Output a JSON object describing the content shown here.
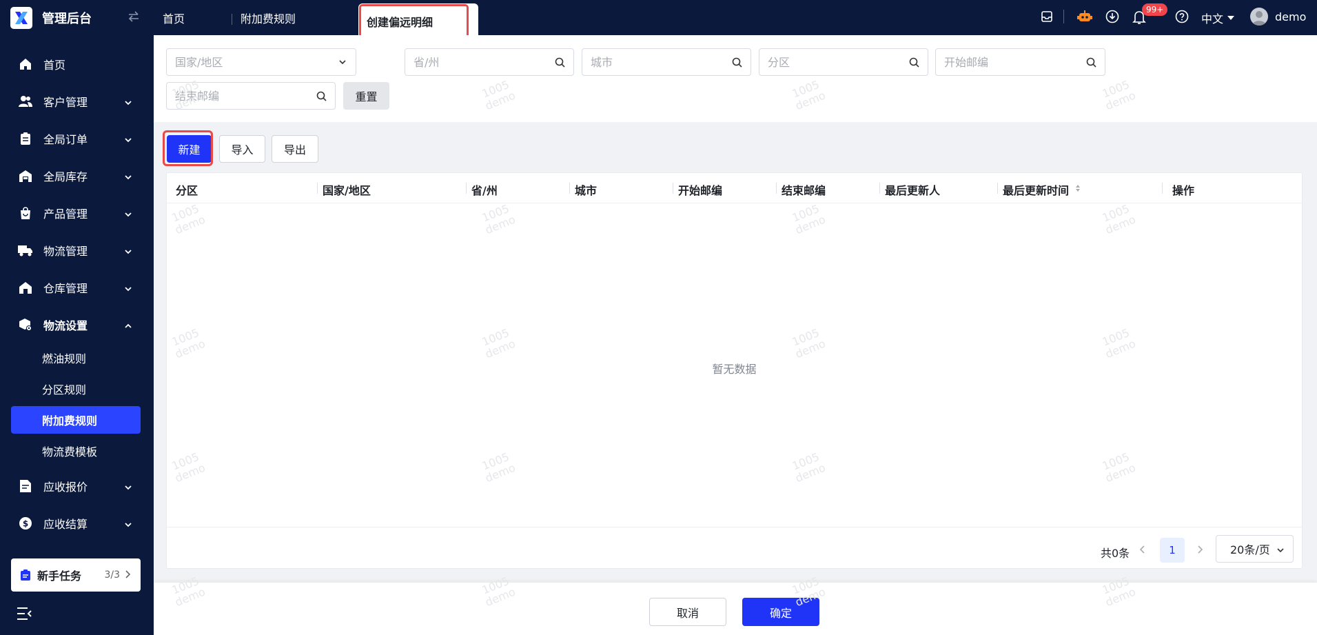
{
  "app": {
    "title": "管理后台"
  },
  "tabs": [
    {
      "label": "首页"
    },
    {
      "label": "附加费规则"
    },
    {
      "label": "创建偏远明细"
    }
  ],
  "topbar": {
    "notification_badge": "99+",
    "language": "中文",
    "username": "demo"
  },
  "sidebar": {
    "items": [
      {
        "label": "首页"
      },
      {
        "label": "客户管理"
      },
      {
        "label": "全局订单"
      },
      {
        "label": "全局库存"
      },
      {
        "label": "产品管理"
      },
      {
        "label": "物流管理"
      },
      {
        "label": "仓库管理"
      },
      {
        "label": "物流设置"
      },
      {
        "label": "应收报价"
      },
      {
        "label": "应收结算"
      }
    ],
    "subitems": [
      {
        "label": "燃油规则"
      },
      {
        "label": "分区规则"
      },
      {
        "label": "附加费规则"
      },
      {
        "label": "物流费模板"
      }
    ],
    "task": {
      "label": "新手任务",
      "progress": "3/3"
    }
  },
  "filters": {
    "country_placeholder": "国家/地区",
    "province_placeholder": "省/州",
    "city_placeholder": "城市",
    "zone_placeholder": "分区",
    "start_zip_placeholder": "开始邮编",
    "end_zip_placeholder": "结束邮编",
    "reset_label": "重置"
  },
  "actions": {
    "new_label": "新建",
    "import_label": "导入",
    "export_label": "导出"
  },
  "table": {
    "columns": [
      "分区",
      "国家/地区",
      "省/州",
      "城市",
      "开始邮编",
      "结束邮编",
      "最后更新人",
      "最后更新时间",
      "操作"
    ],
    "empty_text": "暂无数据"
  },
  "pagination": {
    "total": "共0条",
    "current_page": "1",
    "page_size": "20条/页"
  },
  "footer": {
    "cancel_label": "取消",
    "confirm_label": "确定"
  },
  "watermark": {
    "line1": "1005",
    "line2": "demo"
  },
  "colors": {
    "primary": "#1f34f6",
    "sidebar_bg": "#0b1a3c",
    "highlight": "#e84a4a"
  }
}
